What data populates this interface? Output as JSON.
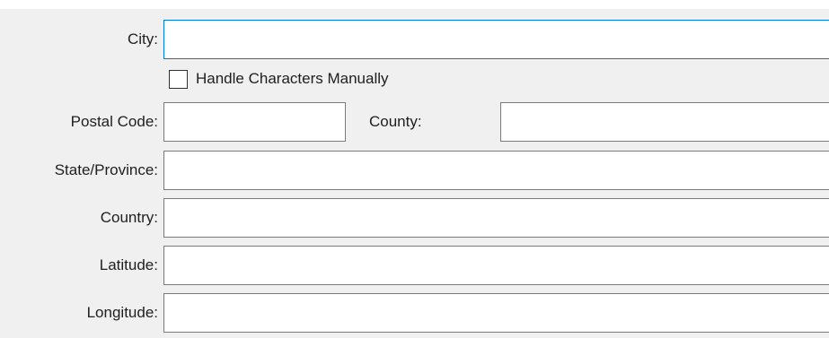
{
  "form": {
    "city": {
      "label": "City:",
      "value": ""
    },
    "handle_characters": {
      "label": "Handle Characters Manually",
      "checked": false
    },
    "postal_code": {
      "label": "Postal Code:",
      "value": ""
    },
    "county": {
      "label": "County:",
      "value": ""
    },
    "state_province": {
      "label": "State/Province:",
      "value": ""
    },
    "country": {
      "label": "Country:",
      "value": ""
    },
    "latitude": {
      "label": "Latitude:",
      "value": ""
    },
    "longitude": {
      "label": "Longitude:",
      "value": ""
    }
  },
  "colors": {
    "panel_bg": "#f0f0f0",
    "focus_border": "#0078d7",
    "field_border": "#7a7a7a"
  }
}
